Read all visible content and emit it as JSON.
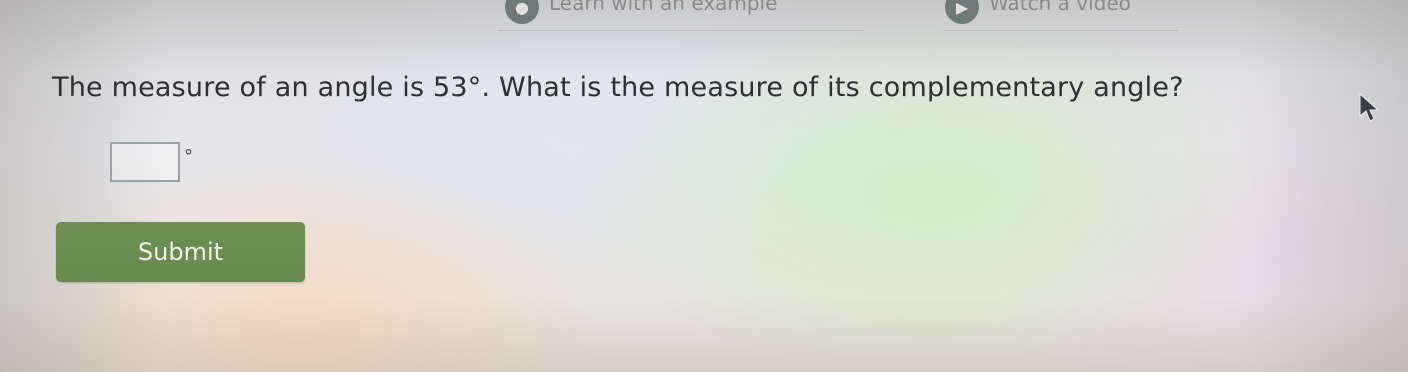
{
  "top_links": {
    "learn_label": "Learn with an example",
    "video_label": "Watch a video"
  },
  "question": {
    "text": "The measure of an angle is 53°. What is the measure of its complementary angle?"
  },
  "answer": {
    "value": "",
    "placeholder": "",
    "unit": "°"
  },
  "submit": {
    "label": "Submit"
  },
  "colors": {
    "submit_bg": "#6b8c52",
    "question_text": "#2f3033"
  }
}
